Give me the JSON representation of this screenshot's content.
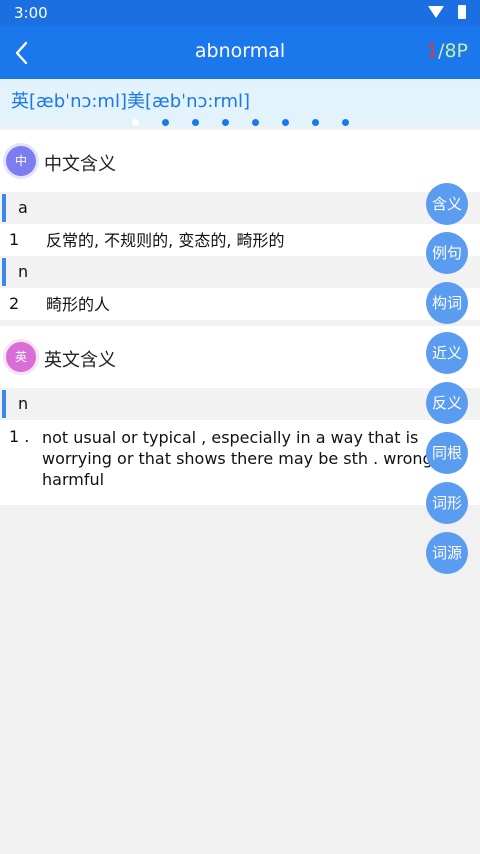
{
  "status": {
    "time": "3:00"
  },
  "header": {
    "title": "abnormal",
    "page_current": "1",
    "page_rest": "/8P"
  },
  "phonetics": {
    "uk": "英[æbˈnɔ:ml]",
    "us": "美[æbˈnɔ:rml]"
  },
  "chinese": {
    "icon": "中",
    "title": "中文含义",
    "pos1": "a",
    "def1_num": "1",
    "def1_text": "反常的, 不规则的, 变态的, 畸形的",
    "pos2": "n",
    "def2_num": "2",
    "def2_text": "畸形的人"
  },
  "english": {
    "icon": "英",
    "title": "英文含义",
    "pos1": "n",
    "def1_num": "1 .",
    "def1_text": "not usual or typical , especially in a way that is worrying or that shows there may be sth . wrong or harmful"
  },
  "fabs": [
    "含义",
    "例句",
    "构词",
    "近义",
    "反义",
    "同根",
    "词形",
    "词源"
  ],
  "colors": {
    "primary": "#1b77ec",
    "fab": "#5a9cf0",
    "page_current": "#e8352e",
    "page_rest": "#bff0a6"
  }
}
